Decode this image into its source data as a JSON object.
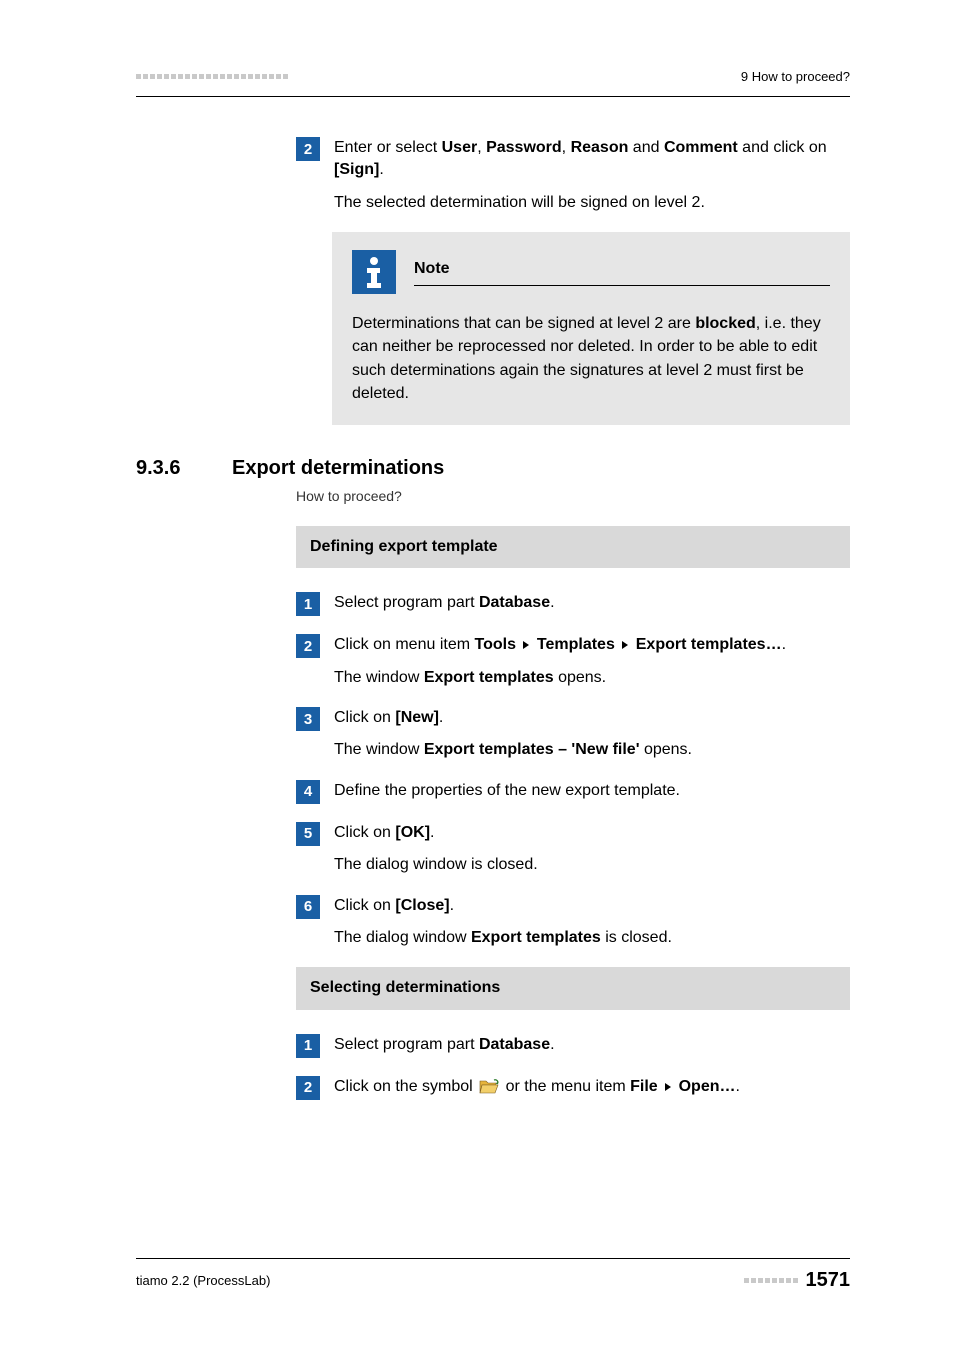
{
  "header": {
    "right_text": "9 How to proceed?"
  },
  "top_step": {
    "num": "2",
    "line1_pre": "Enter or select ",
    "b_user": "User",
    "sep1": ", ",
    "b_pass": "Password",
    "sep2": ", ",
    "b_reason": "Reason",
    "sep3": " and ",
    "b_comment": "Comment",
    "line1_post": " and click on ",
    "b_sign": "[Sign]",
    "period": ".",
    "line2": "The selected determination will be signed on level 2."
  },
  "note": {
    "title": "Note",
    "pre": "Determinations that can be signed at level 2 are ",
    "b_blocked": "blocked",
    "post": ", i.e. they can neither be reprocessed nor deleted. In order to be able to edit such determinations again the signatures at level 2 must first be deleted."
  },
  "section": {
    "num": "9.3.6",
    "title": "Export determinations",
    "sub": "How to proceed?"
  },
  "box1": {
    "title": "Defining export template",
    "s1": {
      "num": "1",
      "pre": "Select program part ",
      "bold": "Database",
      "post": "."
    },
    "s2": {
      "num": "2",
      "pre": "Click on menu item ",
      "b_tools": "Tools",
      "b_templates": "Templates",
      "b_export": "Export templates…",
      "post": ".",
      "line2_pre": "The window ",
      "line2_b": "Export templates",
      "line2_post": " opens."
    },
    "s3": {
      "num": "3",
      "pre": "Click on ",
      "bold": "[New]",
      "post": ".",
      "line2_pre": "The window ",
      "line2_b": "Export templates – 'New file'",
      "line2_post": " opens."
    },
    "s4": {
      "num": "4",
      "text": "Define the properties of the new export template."
    },
    "s5": {
      "num": "5",
      "pre": "Click on ",
      "bold": "[OK]",
      "post": ".",
      "line2": "The dialog window is closed."
    },
    "s6": {
      "num": "6",
      "pre": "Click on ",
      "bold": "[Close]",
      "post": ".",
      "line2_pre": "The dialog window ",
      "line2_b": "Export templates",
      "line2_post": " is closed."
    }
  },
  "box2": {
    "title": "Selecting determinations",
    "s1": {
      "num": "1",
      "pre": "Select program part ",
      "bold": "Database",
      "post": "."
    },
    "s2": {
      "num": "2",
      "pre": "Click on the symbol ",
      "mid": " or the menu item ",
      "b_file": "File",
      "b_open": "Open…",
      "post": "."
    }
  },
  "footer": {
    "left": "tiamo 2.2 (ProcessLab)",
    "page": "1571"
  }
}
